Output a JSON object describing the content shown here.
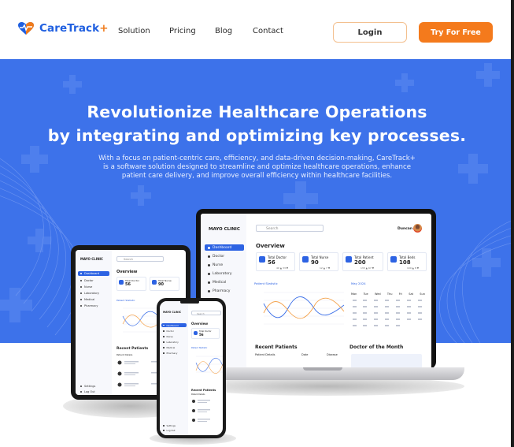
{
  "brand": {
    "name": "CareTrack",
    "suffix": "+"
  },
  "nav": {
    "links": [
      "Solution",
      "Pricing",
      "Blog",
      "Contact"
    ],
    "login_label": "Login",
    "try_label": "Try For Free"
  },
  "hero": {
    "title_line1": "Revolutionize Healthcare Operations",
    "title_line2": "by integrating and optimizing key processes.",
    "desc_line1": "With a focus on patient-centric care, efficiency, and data-driven decision-making, CareTrack+",
    "desc_line2": "is a software solution designed to streamline and optimize healthcare operations, enhance",
    "desc_line3": "patient care delivery, and improve overall efficiency within healthcare facilities."
  },
  "dashboard": {
    "logo": "MAYO CLINIC",
    "search_placeholder": "Search",
    "user": "Duncan",
    "overview": "Overview",
    "sidebar": [
      "Dashboard",
      "Doctor",
      "Nurse",
      "Laboratory",
      "Medical",
      "Pharmacy"
    ],
    "settings": "Settings",
    "logout": "Log Out",
    "stats": [
      {
        "label": "Total Doctor",
        "value": "56"
      },
      {
        "label": "Total Nurse",
        "value": "90"
      },
      {
        "label": "Total Patient",
        "value": "200"
      },
      {
        "label": "Total Beds",
        "value": "108"
      }
    ],
    "stat_sub": [
      "40 ▲ 33 ▼",
      "12 ▲ 7 ▼",
      "133 ▲ 67 ▼",
      "100 ▲ 8 ▼"
    ],
    "patient_statistic": "Patient Statistic",
    "month_label": "May 2024",
    "weekdays": [
      "Mon",
      "Tue",
      "Wed",
      "Thu",
      "Fri",
      "Sat",
      "Sun"
    ],
    "recent_patients": "Recent Patients",
    "recent_cols": [
      "Patient Details",
      "Date",
      "Disease"
    ],
    "doctor_of_month": "Doctor of the Month"
  },
  "colors": {
    "brand_blue": "#1f5fe0",
    "hero_blue": "#3d72ea",
    "accent_orange": "#f47a1c"
  }
}
